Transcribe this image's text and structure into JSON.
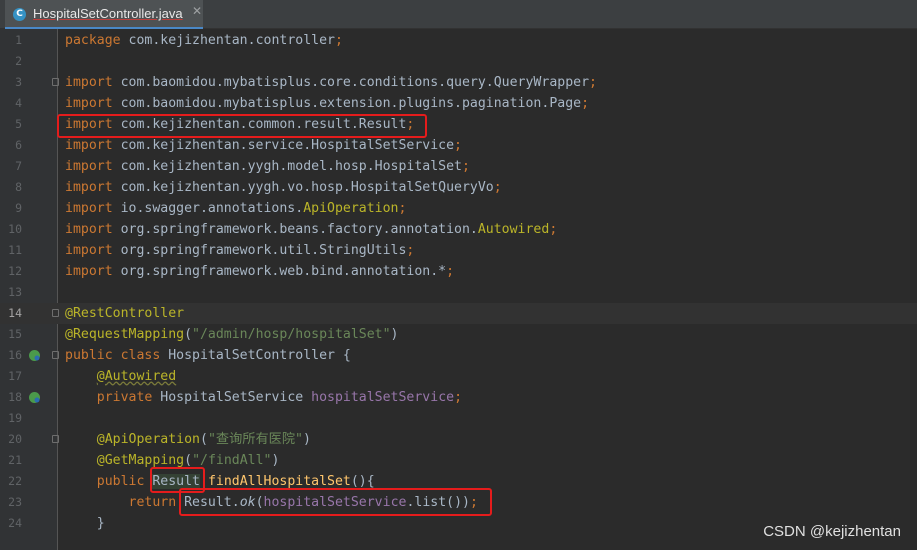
{
  "tab": {
    "icon": "C",
    "title": "HospitalSetController.java",
    "close": "✕"
  },
  "lines": [
    {
      "n": "1",
      "html": [
        [
          "kw",
          "package "
        ],
        [
          "cls",
          "com.kejizhentan.controller"
        ],
        [
          "semi",
          ";"
        ]
      ]
    },
    {
      "n": "2",
      "html": []
    },
    {
      "n": "3",
      "html": [
        [
          "kw",
          "import "
        ],
        [
          "cls",
          "com.baomidou.mybatisplus.core.conditions.query.QueryWrapper"
        ],
        [
          "semi",
          ";"
        ]
      ]
    },
    {
      "n": "4",
      "html": [
        [
          "kw",
          "import "
        ],
        [
          "cls",
          "com.baomidou.mybatisplus.extension.plugins.pagination.Page"
        ],
        [
          "semi",
          ";"
        ]
      ]
    },
    {
      "n": "5",
      "html": [
        [
          "kw",
          "import "
        ],
        [
          "cls",
          "com.kejizhentan.common.result.Result"
        ],
        [
          "semi",
          ";"
        ]
      ]
    },
    {
      "n": "6",
      "html": [
        [
          "kw",
          "import "
        ],
        [
          "cls",
          "com.kejizhentan.service.HospitalSetService"
        ],
        [
          "semi",
          ";"
        ]
      ]
    },
    {
      "n": "7",
      "html": [
        [
          "kw",
          "import "
        ],
        [
          "cls",
          "com.kejizhentan.yygh.model.hosp.HospitalSet"
        ],
        [
          "semi",
          ";"
        ]
      ]
    },
    {
      "n": "8",
      "html": [
        [
          "kw",
          "import "
        ],
        [
          "cls",
          "com.kejizhentan.yygh.vo.hosp.HospitalSetQueryVo"
        ],
        [
          "semi",
          ";"
        ]
      ]
    },
    {
      "n": "9",
      "html": [
        [
          "kw",
          "import "
        ],
        [
          "cls",
          "io.swagger.annotations."
        ],
        [
          "ann",
          "ApiOperation"
        ],
        [
          "semi",
          ";"
        ]
      ]
    },
    {
      "n": "10",
      "html": [
        [
          "kw",
          "import "
        ],
        [
          "cls",
          "org.springframework.beans.factory.annotation."
        ],
        [
          "ann",
          "Autowired"
        ],
        [
          "semi",
          ";"
        ]
      ]
    },
    {
      "n": "11",
      "html": [
        [
          "kw",
          "import "
        ],
        [
          "cls",
          "org.springframework.util.StringUtils"
        ],
        [
          "semi",
          ";"
        ]
      ]
    },
    {
      "n": "12",
      "html": [
        [
          "kw",
          "import "
        ],
        [
          "cls",
          "org.springframework.web.bind.annotation.*"
        ],
        [
          "semi",
          ";"
        ]
      ]
    },
    {
      "n": "13",
      "html": []
    },
    {
      "n": "14",
      "html": [
        [
          "ann",
          "@RestController"
        ]
      ]
    },
    {
      "n": "15",
      "html": [
        [
          "ann",
          "@RequestMapping"
        ],
        [
          "cls",
          "("
        ],
        [
          "str",
          "\"/admin/hosp/hospitalSet\""
        ],
        [
          "cls",
          ")"
        ]
      ]
    },
    {
      "n": "16",
      "html": [
        [
          "kw",
          "public class "
        ],
        [
          "cls",
          "HospitalSetController {"
        ]
      ]
    },
    {
      "n": "17",
      "html": [
        [
          "cls",
          "    "
        ],
        [
          "ann under",
          "@Autowired"
        ]
      ]
    },
    {
      "n": "18",
      "html": [
        [
          "cls",
          "    "
        ],
        [
          "kw",
          "private "
        ],
        [
          "cls",
          "HospitalSetService "
        ],
        [
          "fld",
          "hospitalSetService"
        ],
        [
          "semi",
          ";"
        ]
      ]
    },
    {
      "n": "19",
      "html": []
    },
    {
      "n": "20",
      "html": [
        [
          "cls",
          "    "
        ],
        [
          "ann",
          "@ApiOperation"
        ],
        [
          "cls",
          "("
        ],
        [
          "str",
          "\"查询所有医院\""
        ],
        [
          "cls",
          ")"
        ]
      ]
    },
    {
      "n": "21",
      "html": [
        [
          "cls",
          "    "
        ],
        [
          "ann",
          "@GetMapping"
        ],
        [
          "cls",
          "("
        ],
        [
          "str",
          "\"/findAll\""
        ],
        [
          "cls",
          ")"
        ]
      ]
    },
    {
      "n": "22",
      "html": [
        [
          "cls",
          "    "
        ],
        [
          "kw",
          "public "
        ],
        [
          "cls hl-ref",
          "Result"
        ],
        [
          "cls",
          " "
        ],
        [
          "fn",
          "findAllHospitalSet"
        ],
        [
          "cls",
          "(){"
        ]
      ]
    },
    {
      "n": "23",
      "html": [
        [
          "cls",
          "        "
        ],
        [
          "kw",
          "return "
        ],
        [
          "cls",
          "Result."
        ],
        [
          "cls it",
          "ok"
        ],
        [
          "cls",
          "("
        ],
        [
          "fld",
          "hospitalSetService"
        ],
        [
          "cls",
          ".list())"
        ],
        [
          "semi",
          ";"
        ]
      ]
    },
    {
      "n": "24",
      "html": [
        [
          "cls",
          "    }"
        ]
      ]
    }
  ],
  "current_line": "14",
  "watermark": "CSDN @kejizhentan"
}
